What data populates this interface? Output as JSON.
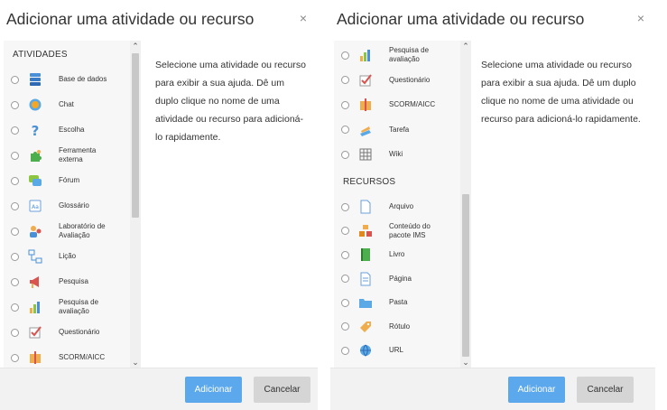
{
  "left_dialog": {
    "title": "Adicionar uma atividade ou recurso",
    "close_glyph": "×",
    "section_activities": "ATIVIDADES",
    "items": [
      {
        "label": "Base de dados",
        "icon": "database-icon"
      },
      {
        "label": "Chat",
        "icon": "chat-icon"
      },
      {
        "label": "Escolha",
        "icon": "question-icon"
      },
      {
        "label": "Ferramenta externa",
        "icon": "puzzle-icon"
      },
      {
        "label": "Fórum",
        "icon": "forum-icon"
      },
      {
        "label": "Glossário",
        "icon": "glossary-icon"
      },
      {
        "label": "Laboratório de Avaliação",
        "icon": "workshop-icon"
      },
      {
        "label": "Lição",
        "icon": "lesson-icon"
      },
      {
        "label": "Pesquisa",
        "icon": "megaphone-icon"
      },
      {
        "label": "Pesquisa de avaliação",
        "icon": "feedback-chart-icon"
      },
      {
        "label": "Questionário",
        "icon": "quiz-check-icon"
      },
      {
        "label": "SCORM/AICC",
        "icon": "scorm-package-icon"
      }
    ],
    "help_text": "Selecione uma atividade ou recurso para exibir a sua ajuda. Dê um duplo clique no nome de uma atividade ou recurso para adicioná-lo rapidamente.",
    "add_label": "Adicionar",
    "cancel_label": "Cancelar"
  },
  "right_dialog": {
    "title": "Adicionar uma atividade ou recurso",
    "close_glyph": "×",
    "activity_items": [
      {
        "label": "Pesquisa de avaliação",
        "icon": "feedback-chart-icon"
      },
      {
        "label": "Questionário",
        "icon": "quiz-check-icon"
      },
      {
        "label": "SCORM/AICC",
        "icon": "scorm-package-icon"
      },
      {
        "label": "Tarefa",
        "icon": "assignment-icon"
      },
      {
        "label": "Wiki",
        "icon": "wiki-icon"
      }
    ],
    "section_resources": "RECURSOS",
    "resource_items": [
      {
        "label": "Arquivo",
        "icon": "file-icon"
      },
      {
        "label": "Conteúdo do pacote IMS",
        "icon": "ims-package-icon"
      },
      {
        "label": "Livro",
        "icon": "book-icon"
      },
      {
        "label": "Página",
        "icon": "page-icon"
      },
      {
        "label": "Pasta",
        "icon": "folder-icon"
      },
      {
        "label": "Rótulo",
        "icon": "label-tag-icon"
      },
      {
        "label": "URL",
        "icon": "url-globe-icon"
      }
    ],
    "help_text": "Selecione uma atividade ou recurso para exibir a sua ajuda. Dê um duplo clique no nome de uma atividade ou recurso para adicioná-lo rapidamente.",
    "add_label": "Adicionar",
    "cancel_label": "Cancelar"
  },
  "scroll_up_glyph": "⌃",
  "scroll_down_glyph": "⌄",
  "colors": {
    "primary_button": "#5ca8ec",
    "secondary_button": "#d5d5d5",
    "list_background": "#f7f7f7",
    "footer_background": "#f2f2f2"
  }
}
